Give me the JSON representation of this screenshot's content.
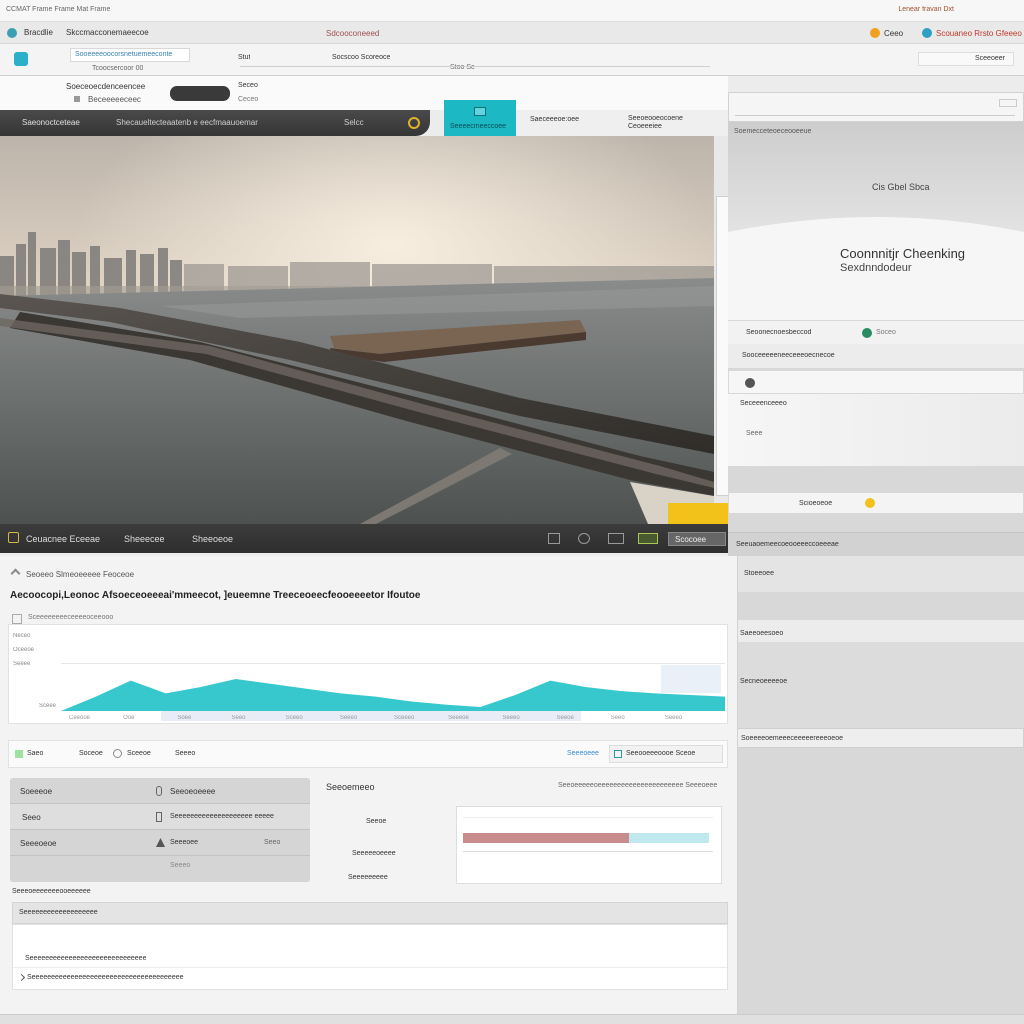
{
  "window": {
    "title": "CCMAT Frame Frame Mat Frame",
    "title_right": "Lenear fravan Dxt"
  },
  "tabs": {
    "tab1": "Bracdlie",
    "tab2": "Skccmacconemaeecoe",
    "center": "Sdcooconeeed",
    "right1": "Ceeo",
    "right2": "Scouaneo Rrsto Gfeeeo"
  },
  "address": {
    "url": "Sooeeeeoocorsnetuemeeconte",
    "sub": "Tcoocsercoor 00",
    "mid1": "Stut",
    "mid2": "Socscoo Scoreoce",
    "mid3": "Stoo Sc",
    "right": "Sceeoeer"
  },
  "toolbar": {
    "line1": "Soeceoecdenceencee",
    "line2": "Beceeeeeceec",
    "mini": "Seceo",
    "mini2": "Ceceo",
    "pill_label": ""
  },
  "player": {
    "left": "Saeonoctceteae",
    "mid": "Shecaueltecteaatenb e eecfmaauoemar",
    "num": "Selcc",
    "teal": "Seeeecmeeccoee",
    "right1": "Saeceeeoe:oee",
    "right2": "Seeoeooeocoene\nCeoeeeiee"
  },
  "video_controls": {
    "item1": "Ceuacnee Eceeae",
    "item2": "Sheeecee",
    "item3": "Sheeoeoe",
    "button": "Scocoee"
  },
  "right_panel": {
    "head": "Soemecceteoeceooeeue",
    "hero_small": "Cis Gbel Sbca",
    "hero_title": "Coonnnitjr Cheenking",
    "hero_sub": "Sexdnndodeur",
    "row1": "Seoonecnoesbeccod",
    "row1_right": "Soceo",
    "row2": "Sooceeeeeneeceeeoecnecoe",
    "row3": "Seceeenceeeo",
    "row4": "Seee",
    "row5": "Scioeoeoe",
    "row6": "Seeuaoemeecoeooeeeccoeeeae",
    "row7": "Stoeeoee",
    "row8": "Saeeoeesoeo",
    "row9": "Secneoeeeeoe",
    "row10": "Soeeeeoemeeeceeeeereeeoeoe"
  },
  "lower": {
    "crumb": "Seoeeo Slmeoeeeee Feoceoe",
    "heading": "Aecoocopi,Leonoc Afsoeceoeeeai'mmeecot, ]eueemne Treeceoeecfeooeeeetor Ifoutoe",
    "chart_caption": "Sceeeeeeeeceeeeoceeooo",
    "chart_ylabels": [
      "Neceo",
      "Oceeoe",
      "Seeee",
      "Sceee"
    ],
    "chart_xlabels": [
      "Ceeooe",
      "Ooe",
      "Soee",
      "Seeo",
      "Sceeo",
      "Seeeo",
      "Sceeeo",
      "Seeeoe",
      "Seeeo",
      "Seeoe",
      "Seeo",
      "Seeeo"
    ],
    "tools": [
      "Saeo",
      "Soceoe",
      "Sceeoe",
      "Seeeo"
    ],
    "tools_right": "Seeeoeee",
    "tools_right2": "Seeooeeeoooe Sceoe"
  },
  "chart_data": {
    "type": "area",
    "series": [
      {
        "values": [
          0,
          18,
          38,
          22,
          30,
          40,
          34,
          28,
          22,
          18,
          12,
          8,
          5,
          20,
          38,
          30,
          25,
          22,
          20,
          18
        ]
      }
    ],
    "ylim": [
      0,
      100
    ],
    "colors": [
      "#20c2c8"
    ]
  },
  "settings": {
    "title": "Soeeeoe",
    "head_right": "Seeoeoeeee",
    "rows": [
      {
        "label": "Seeo",
        "value": "Seeeeeeeeeeeeeeeeeeee eeeee"
      },
      {
        "label": "Seeeoeoe",
        "value": "Seeeoee",
        "extra": "Seeo"
      },
      {
        "label": "",
        "value": "Seeeo"
      }
    ]
  },
  "preview": {
    "title": "Seeoemeeo",
    "hint": "Seeoeeeeeoeeeeeeeeeeeeeeeeeeeeee Seeeoeee",
    "labels": [
      "Seeoe",
      "Seeeeeoeeee",
      "Seeeeeeeee"
    ]
  },
  "sections": {
    "label": "Seeeoeeeeeeeooeeeeee",
    "bar": "Seeeeeeeeeeeeeeeeeee",
    "item1": "Seeeeeeeeeeeeeeeeeeeeeeeeeeeeee",
    "item2": "Seeeeeeeeeeeeeeeeeeeeeeeeeeeeeeeeeeeeeee"
  },
  "colors": {
    "accent": "#1cb8c4",
    "yellow": "#f2c21a",
    "dark": "#353535"
  }
}
